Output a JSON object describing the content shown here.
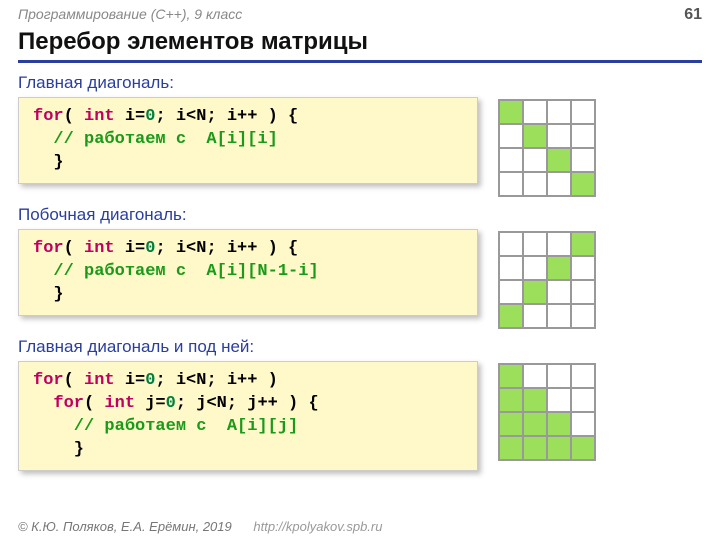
{
  "header": {
    "course": "Программирование (С++), 9 класс",
    "page": "61"
  },
  "title": "Перебор элементов матрицы",
  "sections": {
    "s1": {
      "label": "Главная диагональ:",
      "code": {
        "for1": "for",
        "lp1": "( ",
        "int1": "int",
        "sp1": " i=",
        "z1": "0",
        "rest1": "; i<N; i++ ) {",
        "cmt": "  // работаем с  A[i][i]",
        "brace": "  }"
      },
      "grid": [
        1,
        0,
        0,
        0,
        0,
        1,
        0,
        0,
        0,
        0,
        1,
        0,
        0,
        0,
        0,
        1
      ]
    },
    "s2": {
      "label": "Побочная диагональ:",
      "code": {
        "for1": "for",
        "lp1": "( ",
        "int1": "int",
        "sp1": " i=",
        "z1": "0",
        "rest1": "; i<N; i++ ) {",
        "cmt": "  // работаем с  A[i][N-1-i]",
        "brace": "  }"
      },
      "grid": [
        0,
        0,
        0,
        1,
        0,
        0,
        1,
        0,
        0,
        1,
        0,
        0,
        1,
        0,
        0,
        0
      ]
    },
    "s3": {
      "label": "Главная диагональ и под ней:",
      "code": {
        "for1": "for",
        "lp1": "( ",
        "int1": "int",
        "sp1": " i=",
        "z1": "0",
        "rest1": "; i<N; i++ ) ",
        "for2": "for",
        "lp2": "( ",
        "int2": "int",
        "sp2": " j=",
        "z2": "0",
        "rest2": "; j<N; j++ ) {",
        "cmt": "    // работаем с  A[i][j]",
        "brace": "    }"
      },
      "grid": [
        1,
        0,
        0,
        0,
        1,
        1,
        0,
        0,
        1,
        1,
        1,
        0,
        1,
        1,
        1,
        1
      ]
    }
  },
  "footer": {
    "credit": "© К.Ю. Поляков, Е.А. Ерёмин, 2019",
    "url": "http://kpolyakov.spb.ru"
  }
}
